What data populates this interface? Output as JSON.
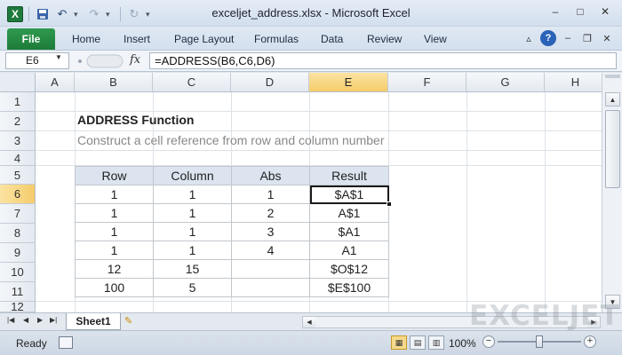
{
  "window": {
    "title": "exceljet_address.xlsx - Microsoft Excel",
    "app_icon_letter": "X",
    "controls": [
      "–",
      "□",
      "✕"
    ]
  },
  "ribbon": {
    "file_label": "File",
    "tabs": [
      "Home",
      "Insert",
      "Page Layout",
      "Formulas",
      "Data",
      "Review",
      "View"
    ]
  },
  "formula_bar": {
    "name_box": "E6",
    "fx_label": "fx",
    "formula": "=ADDRESS(B6,C6,D6)"
  },
  "grid": {
    "columns": [
      "A",
      "B",
      "C",
      "D",
      "E",
      "F",
      "G",
      "H"
    ],
    "rows": [
      "1",
      "2",
      "3",
      "4",
      "5",
      "6",
      "7",
      "8",
      "9",
      "10",
      "11",
      "12"
    ],
    "active_column": "E",
    "active_row": "6"
  },
  "sheet": {
    "heading": "ADDRESS Function",
    "subheading": "Construct a cell reference from row and column number",
    "table": {
      "headers": [
        "Row",
        "Column",
        "Abs",
        "Result"
      ],
      "rows": [
        [
          "1",
          "1",
          "1",
          "$A$1"
        ],
        [
          "1",
          "1",
          "2",
          "A$1"
        ],
        [
          "1",
          "1",
          "3",
          "$A1"
        ],
        [
          "1",
          "1",
          "4",
          "A1"
        ],
        [
          "12",
          "15",
          "",
          "$O$12"
        ],
        [
          "100",
          "5",
          "",
          "$E$100"
        ]
      ]
    }
  },
  "sheet_tabs": {
    "active": "Sheet1"
  },
  "watermark": "EXCELJET",
  "status_bar": {
    "status": "Ready",
    "zoom": "100%",
    "zoom_level_percent": 100
  },
  "colors": {
    "file_tab": "#1d7b38",
    "header_fill": "#dbe4ef",
    "active_header": "#f5cc6a"
  }
}
